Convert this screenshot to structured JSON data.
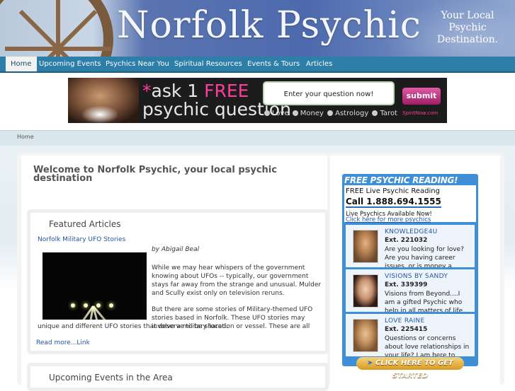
{
  "header": {
    "title": "Norfolk Psychic",
    "tagline": "Your Local Psychic Destination."
  },
  "nav": {
    "items": [
      {
        "label": "Home",
        "active": true
      },
      {
        "label": "Upcoming Events",
        "active": false
      },
      {
        "label": "Psychics Near You",
        "active": false
      },
      {
        "label": "Spiritual Resources",
        "active": false
      },
      {
        "label": "Events & Tours",
        "active": false
      },
      {
        "label": "Articles",
        "active": false
      }
    ]
  },
  "ad": {
    "star": "*",
    "line1_prefix": "ask 1 ",
    "line1_free": "FREE",
    "line2": "psychic question",
    "input_placeholder": "Enter your question now!",
    "submit_label": "submit",
    "brand": "SpiritNow.com",
    "options": [
      "Love",
      "Money",
      "Astrology",
      "Tarot"
    ]
  },
  "breadcrumb": "Home",
  "main": {
    "welcome": "Welcome to Norfolk Psychic, your local psychic destination",
    "featured": {
      "title": "Featured Articles",
      "article_title": "Norfolk Military UFO Stories",
      "author": "by Abigail Beal",
      "paragraph1": "While we may hear whispers of the government knowing about UFOs -- typically, our government stays far away from the strange and unusual. Mulder and Scully exist only on television reruns.",
      "paragraph2": "But there are some stories of Military-themed UFO stories based in Norfolk. These UFO stories may involve a military location or vessel. These are all",
      "paragraph2_cont": "unique and different UFO stories that deserve to be shared.",
      "read_more": "Read more...Link"
    },
    "events": {
      "title": "Upcoming Events in the Area"
    }
  },
  "sidebar": {
    "free_reading": "FREE PSYCHIC READING!",
    "live_reading": "FREE Live Psychic Reading",
    "call": "Call 1.888.694.1555",
    "available": "Live Psychics Available Now!",
    "click_here": "Click here for more psychics",
    "psychics": [
      {
        "name": "KNOWLEDGE4U",
        "ext": "Ext. 221032",
        "desc": "Are you looking for love? Are you having career issues, or is money a"
      },
      {
        "name": "VISIONS BY SANDY",
        "ext": "Ext. 339399",
        "desc": "Visions from Beyond....I am a gifted Psychic who help in all matters of life."
      },
      {
        "name": "LOVE RAINE",
        "ext": "Ext. 225415",
        "desc": "Questions or concerns about love relationships in your life? I am here to"
      }
    ],
    "get_started": "CLICK HERE TO GET STARTED"
  }
}
